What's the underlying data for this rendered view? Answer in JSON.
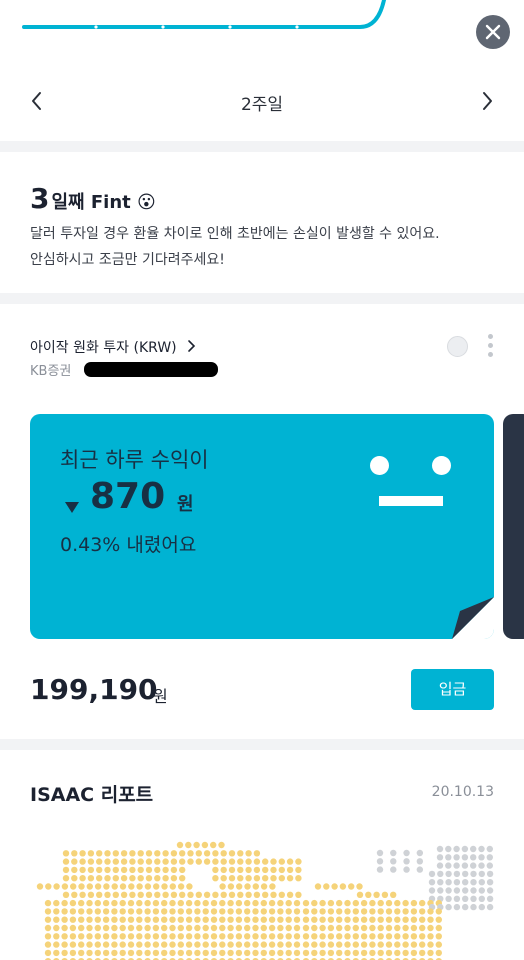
{
  "header": {
    "close_icon": "close-icon",
    "week_title": "2주일",
    "prev_icon": "chevron-left-icon",
    "next_icon": "chevron-right-icon"
  },
  "fint": {
    "day_number": "3",
    "day_suffix": "일째 Fint",
    "emoji": "😮",
    "message_line1": "달러 투자일 경우 환율 차이로 인해 초반에는 손실이 발생할 수 있어요.",
    "message_line2": "안심하시고 조금만 기다려주세요!"
  },
  "account": {
    "name": "아이작 원화 투자 (KRW)",
    "broker": "KB증권"
  },
  "profit_card": {
    "label": "최근 하루 수익이",
    "amount": "870",
    "unit": "원",
    "rate": "0.43% 내렸어요",
    "direction": "down",
    "color": "#00b3d3"
  },
  "balance": {
    "amount": "199,190",
    "unit": "원",
    "deposit_label": "입금"
  },
  "report": {
    "title": "ISAAC 리포트",
    "date": "20.10.13"
  },
  "colors": {
    "accent": "#00b3d3",
    "dark": "#2a3445",
    "map_dot": "#f5d37a",
    "map_dot_gray": "#cfd2d6"
  }
}
